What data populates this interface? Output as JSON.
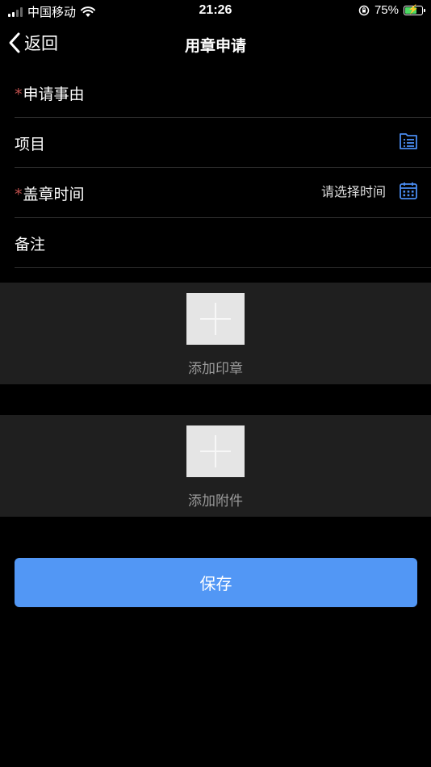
{
  "status_bar": {
    "carrier": "中国移动",
    "time": "21:26",
    "battery_percent": "75%",
    "battery_level": 0.75,
    "battery_color": "#4cd964"
  },
  "nav": {
    "back_label": "返回",
    "title": "用章申请",
    "back_icon": "chevron-left-icon"
  },
  "form": {
    "reason": {
      "label": "申请事由",
      "required": true
    },
    "project": {
      "label": "项目",
      "icon": "list-icon"
    },
    "stamp_time": {
      "label": "盖章时间",
      "required": true,
      "placeholder": "请选择时间",
      "icon": "calendar-icon"
    },
    "remark": {
      "label": "备注"
    }
  },
  "uploads": {
    "seal": {
      "label": "添加印章",
      "icon": "plus-icon"
    },
    "attachment": {
      "label": "添加附件",
      "icon": "plus-icon"
    }
  },
  "actions": {
    "save_label": "保存"
  },
  "colors": {
    "background": "#000000",
    "accent": "#5297f5",
    "icon_blue": "#4a8cf0",
    "required": "#c0504d",
    "section_bg": "#1f1f1f",
    "divider": "#2a2a2a"
  }
}
